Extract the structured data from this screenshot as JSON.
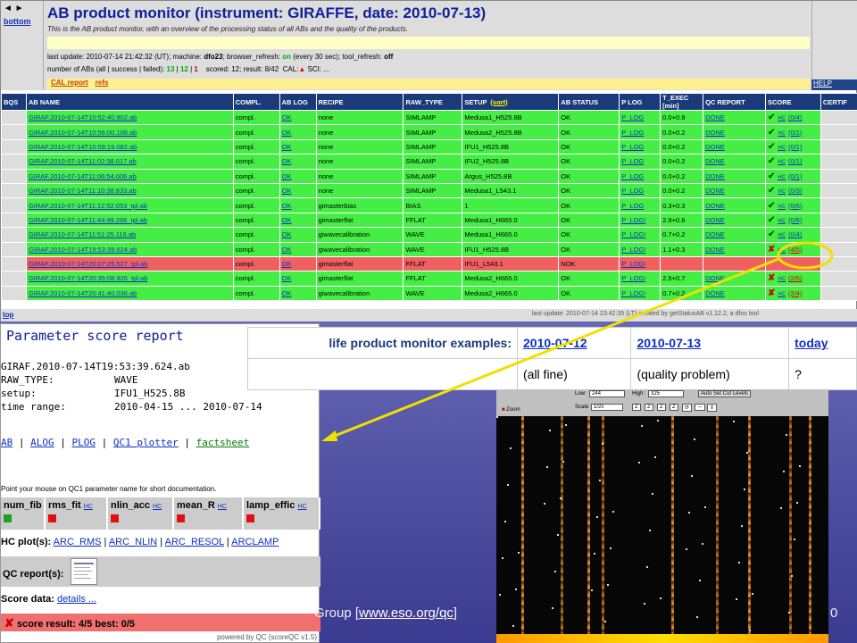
{
  "monitor": {
    "nav_arrows": "◄ ►",
    "nav_bottom": "bottom",
    "title": "AB product monitor (instrument: GIRAFFE, date: 2010-07-13)",
    "subtitle": "This is the AB product monitor, with an overview of the processing status of all ABs and the quality of the products.",
    "last_update_prefix": "last update: 2010-07-14 21:42:32 (UT); machine: ",
    "machine": "dfo23",
    "browser_refresh_prefix": "; browser_refresh: ",
    "browser_refresh": "on",
    "browser_refresh_suffix": " (every 30 sec); tool_refresh: ",
    "tool_refresh": "off",
    "counts_prefix": "number of ABs (all | success | failed): ",
    "count_all": "13",
    "count_success": "12",
    "count_failed": "1",
    "scored_text": "scored: 12; result: 8/42",
    "cal_label": "CAL:",
    "sci_label": "SCI: ...",
    "cal_report": "CAL report",
    "refs": "refs",
    "help": "HELP"
  },
  "columns": [
    "BQS",
    "AB NAME",
    "COMPL.",
    "AB LOG",
    "RECIPE",
    "RAW_TYPE",
    "SETUP",
    "AB STATUS",
    "P LOG",
    "T_EXEC [min]",
    "QC REPORT",
    "SCORE",
    "CERTIF"
  ],
  "setup_sort": "(sort)",
  "rows": [
    {
      "name": "GIRAF.2010-07-14T10:52:40.902.ab",
      "compl": "compl.",
      "log": "OK",
      "recipe": "none",
      "raw": "SIMLAMP",
      "setup": "Medusa1_H525.8B",
      "status": "OK",
      "plog": "P_LOG",
      "texec": "0.0+0.9",
      "qc": "DONE",
      "score": "(0/4)",
      "mark": "✔",
      "nok": false
    },
    {
      "name": "GIRAF.2010-07-14T10:56:00.108.ab",
      "compl": "compl.",
      "log": "OK",
      "recipe": "none",
      "raw": "SIMLAMP",
      "setup": "Medusa2_H525.8B",
      "status": "OK",
      "plog": "P_LOG",
      "texec": "0.0+0.2",
      "qc": "DONE",
      "score": "(0/1)",
      "mark": "✔",
      "nok": false
    },
    {
      "name": "GIRAF.2010-07-14T10:59:19.082.ab",
      "compl": "compl.",
      "log": "OK",
      "recipe": "none",
      "raw": "SIMLAMP",
      "setup": "IFU1_H525.8B",
      "status": "OK",
      "plog": "P_LOG",
      "texec": "0.0+0.2",
      "qc": "DONE",
      "score": "(0/1)",
      "mark": "✔",
      "nok": false
    },
    {
      "name": "GIRAF.2010-07-14T11:02:38.017.ab",
      "compl": "compl.",
      "log": "OK",
      "recipe": "none",
      "raw": "SIMLAMP",
      "setup": "IFU2_H525.8B",
      "status": "OK",
      "plog": "P_LOG",
      "texec": "0.0+0.2",
      "qc": "DONE",
      "score": "(0/1)",
      "mark": "✔",
      "nok": false
    },
    {
      "name": "GIRAF.2010-07-14T11:06:54.006.ab",
      "compl": "compl.",
      "log": "OK",
      "recipe": "none",
      "raw": "SIMLAMP",
      "setup": "Argus_H525.8B",
      "status": "OK",
      "plog": "P_LOG",
      "texec": "0.0+0.2",
      "qc": "DONE",
      "score": "(0/1)",
      "mark": "✔",
      "nok": false
    },
    {
      "name": "GIRAF.2010-07-14T11:10:38.833.ab",
      "compl": "compl.",
      "log": "OK",
      "recipe": "none",
      "raw": "SIMLAMP",
      "setup": "Medusa1_L543.1",
      "status": "OK",
      "plog": "P_LOG",
      "texec": "0.0+0.2",
      "qc": "DONE",
      "score": "(0/3)",
      "mark": "✔",
      "nok": false
    },
    {
      "name": "GIRAF.2010-07-14T11:12:52.053_tpl.ab",
      "compl": "compl.",
      "log": "OK",
      "recipe": "gimasterbias",
      "raw": "BIAS",
      "setup": "1",
      "status": "OK",
      "plog": "P_LOG",
      "texec": "0.3+0.3",
      "qc": "DONE",
      "score": "(0/6)",
      "mark": "✔",
      "nok": false
    },
    {
      "name": "GIRAF.2010-07-14T11:44:49.266_tpl.ab",
      "compl": "compl.",
      "log": "OK",
      "recipe": "gimasterflat",
      "raw": "FFLAT",
      "setup": "Medusa1_H665.0",
      "status": "OK",
      "plog": "P_LOG!",
      "texec": "2.9+0.6",
      "qc": "DONE",
      "score": "(0/6)",
      "mark": "✔",
      "nok": false
    },
    {
      "name": "GIRAF.2010-07-14T11:51:25.116.ab",
      "compl": "compl.",
      "log": "OK",
      "recipe": "giwavecalibration",
      "raw": "WAVE",
      "setup": "Medusa1_H665.0",
      "status": "OK",
      "plog": "P_LOG!",
      "texec": "0.7+0.2",
      "qc": "DONE",
      "score": "(0/4)",
      "mark": "✔",
      "nok": false
    },
    {
      "name": "GIRAF.2010-07-14T19:53:39.624.ab",
      "compl": "compl.",
      "log": "OK",
      "recipe": "giwavecalibration",
      "raw": "WAVE",
      "setup": "IFU1_H525.8B",
      "status": "OK",
      "plog": "P_LOG!",
      "texec": "1.1+0.3",
      "qc": "DONE",
      "score": "(4/5)",
      "mark": "✘",
      "nok": false
    },
    {
      "name": "GIRAF.2010-07-14T20:07:25.527_tpl.ab",
      "compl": "compl.",
      "log": "OK",
      "recipe": "gimasterflat",
      "raw": "FFLAT",
      "setup": "IFU1_L543.1",
      "status": "NOK",
      "plog": "P_LOG!",
      "texec": "",
      "qc": "",
      "score": "",
      "mark": "",
      "nok": true
    },
    {
      "name": "GIRAF.2010-07-14T20:35:08.926_tpl.ab",
      "compl": "compl.",
      "log": "OK",
      "recipe": "gimasterflat",
      "raw": "FFLAT",
      "setup": "Medusa2_H665.0",
      "status": "OK",
      "plog": "P_LOG!",
      "texec": "2.5+0.7",
      "qc": "DONE",
      "score": "(2/6)",
      "mark": "✘",
      "nok": false
    },
    {
      "name": "GIRAF.2010-07-14T20:41:40.036.ab",
      "compl": "compl.",
      "log": "OK",
      "recipe": "giwavecalibration",
      "raw": "WAVE",
      "setup": "Medusa2_H665.0",
      "status": "OK",
      "plog": "P_LOG!",
      "texec": "0.7+0.2",
      "qc": "DONE",
      "score": "(2/4)",
      "mark": "✘",
      "nok": false
    }
  ],
  "hc_label": "HC",
  "footer_row": {
    "top": "top",
    "info": "last update: 2010-07-14 23:42:35 (LT)          created by getStatusAB v1.12.2, a dfos tool"
  },
  "psr": {
    "title": "Parameter score report",
    "ab_name": "GIRAF.2010-07-14T19:53:39.624.ab",
    "raw_type_label": "RAW_TYPE:",
    "raw_type": "WAVE",
    "setup_label": "setup:",
    "setup": "IFU1_H525.8B",
    "time_range_label": "time range:",
    "time_range": "2010-04-15 ... 2010-07-14",
    "links": [
      "AB",
      "ALOG",
      "PLOG",
      "QC1 plotter"
    ],
    "factsheet": "factsheet",
    "hint": "Point your mouse on QC1 parameter name for short documentation.",
    "params": [
      {
        "name": "num_fib",
        "hc": "",
        "color": "#20a020"
      },
      {
        "name": "rms_fit",
        "hc": "HC",
        "color": "#e01010"
      },
      {
        "name": "nlin_acc",
        "hc": "HC",
        "color": "#e01010"
      },
      {
        "name": "mean_R",
        "hc": "HC",
        "color": "#e01010"
      },
      {
        "name": "lamp_effic",
        "hc": "HC",
        "color": "#e01010"
      }
    ],
    "hc_plots_label": "HC plot(s):",
    "hc_plots": [
      "ARC_RMS",
      "ARC_NLIN",
      "ARC_RESOL",
      "ARCLAMP"
    ],
    "qc_reports_label": "QC report(s):",
    "score_data_label": "Score data:",
    "score_data_link": "details ...",
    "score_result": "score result: 4/5  best: 0/5",
    "powered_by": "powered by QC (scoreQC v1.5)"
  },
  "examples": {
    "label": "life product monitor examples:",
    "links": [
      "2010-07-12",
      "2010-07-13",
      "today"
    ],
    "notes": [
      "(all fine)",
      "(quality problem)",
      "?"
    ]
  },
  "viewer": {
    "low_label": "Low:",
    "low_val": "244",
    "high_label": "High:",
    "high_val": "325",
    "auto_set": "Auto Set Cut Levels",
    "scale_label": "Scale:",
    "scale_val": "1/2x",
    "zoom": "Zoom"
  },
  "footer": {
    "text": "Group [",
    "link": "www.eso.org/qc",
    "close": "]",
    "pagenum": "0"
  }
}
